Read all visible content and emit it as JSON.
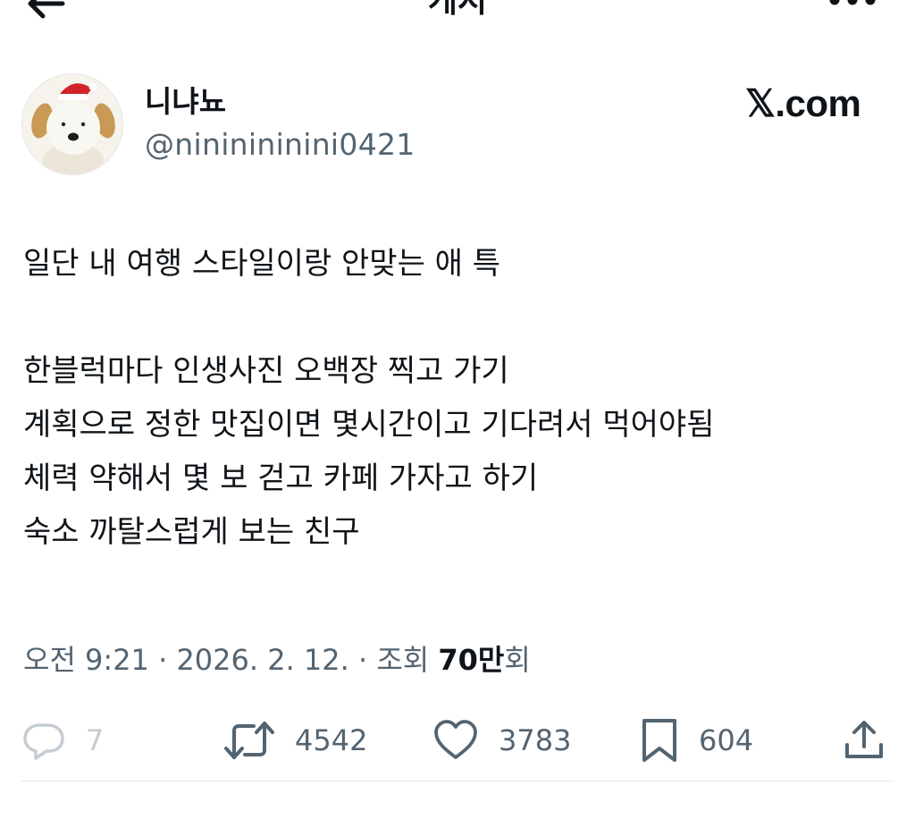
{
  "header": {
    "title": "게시",
    "back_icon": "arrow-left-icon",
    "more_icon": "more-horizontal-icon"
  },
  "author": {
    "display_name": "니냐뇨",
    "handle": "@nininininini0421",
    "avatar_icon": "puppy-santa-hat-avatar"
  },
  "brand": {
    "logo_text": "𝕏.com"
  },
  "post": {
    "lines": [
      "일단 내 여행 스타일이랑 안맞는 애 특",
      "",
      "한블럭마다 인생사진 오백장 찍고 가기",
      "계획으로 정한 맛집이면 몇시간이고 기다려서 먹어야됨",
      "체력 약해서 몇 보 걷고 카페 가자고 하기",
      "숙소 까탈스럽게 보는 친구"
    ]
  },
  "meta": {
    "time": "오전 9:21",
    "separator": " · ",
    "date": "2026. 2. 12.",
    "views_label": "조회 ",
    "views_number": "70만",
    "views_suffix": "회"
  },
  "actions": {
    "reply": {
      "icon": "reply-bubble-icon",
      "count": "7"
    },
    "repost": {
      "icon": "repost-arrows-icon",
      "count": "4542"
    },
    "like": {
      "icon": "heart-icon",
      "count": "3783"
    },
    "bookmark": {
      "icon": "bookmark-icon",
      "count": "604"
    },
    "share": {
      "icon": "share-upload-icon"
    }
  },
  "colors": {
    "text_primary": "#0f1419",
    "text_secondary": "#536471",
    "reply_muted": "#c4cdd4",
    "divider": "#e5e9ec"
  }
}
